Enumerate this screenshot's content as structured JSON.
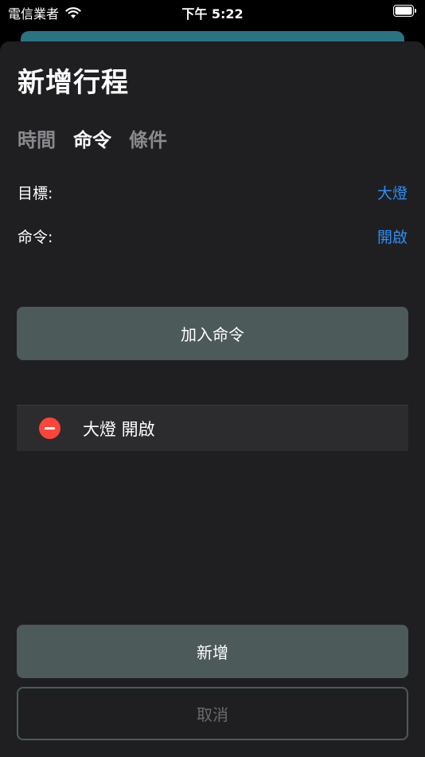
{
  "status_bar": {
    "carrier": "電信業者",
    "time": "下午 5:22"
  },
  "sheet": {
    "title": "新增行程",
    "tabs": [
      {
        "label": "時間",
        "active": false
      },
      {
        "label": "命令",
        "active": true
      },
      {
        "label": "條件",
        "active": false
      }
    ],
    "target": {
      "label": "目標:",
      "value": "大燈"
    },
    "command": {
      "label": "命令:",
      "value": "開啟"
    },
    "add_command_label": "加入命令",
    "commands": [
      {
        "label": "大燈 開啟"
      }
    ],
    "submit_label": "新增",
    "cancel_label": "取消"
  },
  "colors": {
    "accent": "#2f8ef5",
    "button": "#4c5a59",
    "remove": "#ff453a",
    "sheet_bg": "#1f1f21"
  }
}
